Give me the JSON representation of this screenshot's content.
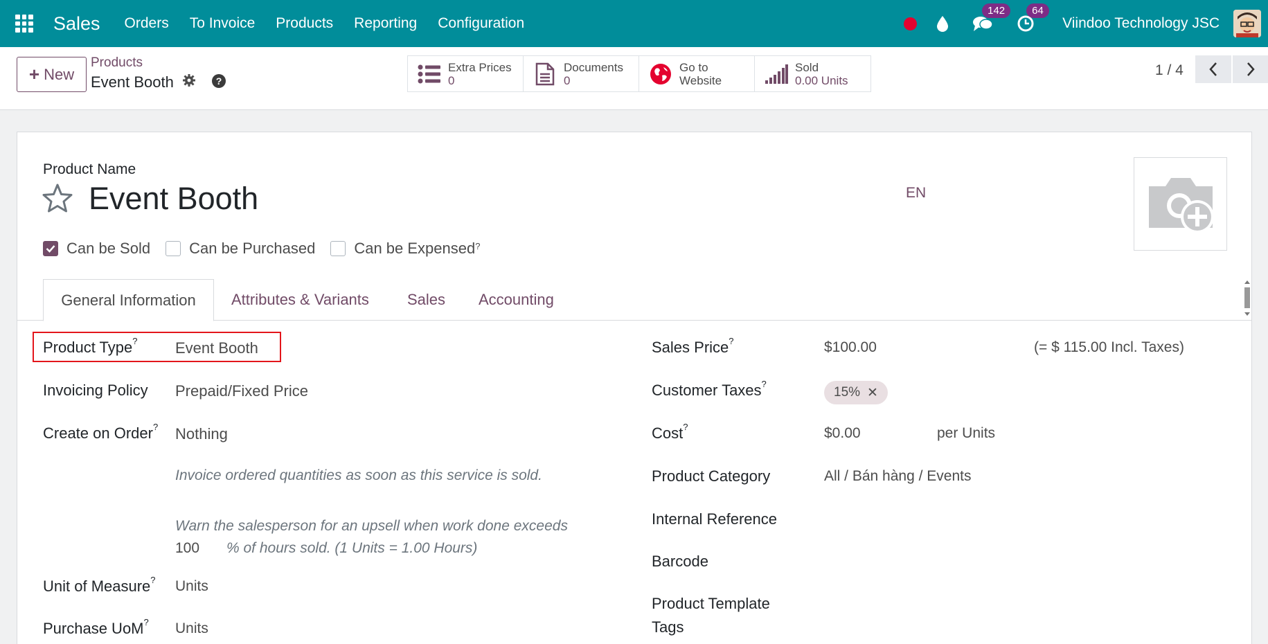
{
  "navbar": {
    "app_name": "Sales",
    "menu": [
      "Orders",
      "To Invoice",
      "Products",
      "Reporting",
      "Configuration"
    ],
    "chat_badge": "142",
    "activity_badge": "64",
    "company": "Viindoo Technology JSC",
    "bg_color": "#018d9a"
  },
  "control": {
    "new_label": "New",
    "breadcrumb_parent": "Products",
    "breadcrumb_current": "Event Booth",
    "stats": [
      {
        "icon": "list-icon",
        "label": "Extra Prices",
        "value": "0"
      },
      {
        "icon": "document-icon",
        "label": "Documents",
        "value": "0"
      },
      {
        "icon": "globe-icon",
        "label": "Go to",
        "value": "Website"
      },
      {
        "icon": "bar-chart-icon",
        "label": "Sold",
        "value": "0.00 Units"
      }
    ],
    "pager": "1 / 4"
  },
  "form": {
    "product_name_label": "Product Name",
    "product_name": "Event Booth",
    "lang": "EN",
    "checkboxes": [
      {
        "label": "Can be Sold",
        "checked": true,
        "help": ""
      },
      {
        "label": "Can be Purchased",
        "checked": false,
        "help": ""
      },
      {
        "label": "Can be Expensed",
        "checked": false,
        "help": "?"
      }
    ],
    "tabs": [
      "General Information",
      "Attributes & Variants",
      "Sales",
      "Accounting"
    ],
    "left": {
      "product_type_label": "Product Type",
      "product_type": "Event Booth",
      "invoicing_policy_label": "Invoicing Policy",
      "invoicing_policy": "Prepaid/Fixed Price",
      "create_on_order_label": "Create on Order",
      "create_on_order": "Nothing",
      "note1": "Invoice ordered quantities as soon as this service is sold.",
      "note2": "Warn the salesperson for an upsell when work done exceeds",
      "upsell_value": "100",
      "note3": "% of hours sold. (1 Units = 1.00 Hours)",
      "uom_label": "Unit of Measure",
      "uom": "Units",
      "purchase_uom_label": "Purchase UoM",
      "purchase_uom": "Units"
    },
    "right": {
      "sales_price_label": "Sales Price",
      "sales_price": "$100.00",
      "incl_taxes": "(= $ 115.00 Incl. Taxes)",
      "customer_taxes_label": "Customer Taxes",
      "tax_tag": "15%",
      "cost_label": "Cost",
      "cost": "$0.00",
      "cost_unit": "per Units",
      "category_label": "Product Category",
      "category": "All / Bán hàng / Events",
      "internal_ref_label": "Internal Reference",
      "barcode_label": "Barcode",
      "template_tags_label_1": "Product Template",
      "template_tags_label_2": "Tags"
    },
    "help_mark": "?"
  }
}
